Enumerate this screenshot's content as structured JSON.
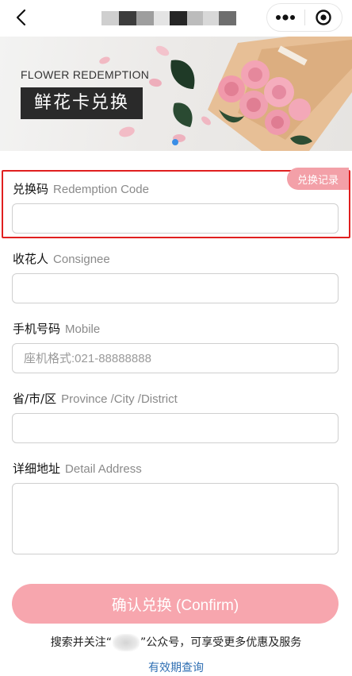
{
  "nav": {
    "back_icon": "chevron-left-icon",
    "more_icon": "more-dots-icon",
    "target_icon": "target-icon"
  },
  "banner": {
    "subtitle": "FLOWER REDEMPTION",
    "title": "鲜花卡兑换"
  },
  "form": {
    "redemption": {
      "label_cn": "兑换码",
      "label_en": "Redemption Code",
      "value": "",
      "placeholder": ""
    },
    "record_tag": "兑换记录",
    "consignee": {
      "label_cn": "收花人",
      "label_en": "Consignee",
      "value": "",
      "placeholder": ""
    },
    "mobile": {
      "label_cn": "手机号码",
      "label_en": "Mobile",
      "value": "",
      "placeholder": "座机格式:021-88888888"
    },
    "province": {
      "label_cn": "省/市/区",
      "label_en": "Province /City /District",
      "value": "",
      "placeholder": ""
    },
    "address": {
      "label_cn": "详细地址",
      "label_en": "Detail Address",
      "value": ""
    },
    "confirm_label": "确认兑换 (Confirm)"
  },
  "footer": {
    "note_prefix": "搜索并关注“",
    "note_suffix": "”公众号，可享受更多优惠及服务",
    "validity_link": "有效期查询"
  },
  "colors": {
    "accent_pink": "#f7a6ae",
    "highlight_red": "#e02020",
    "link_blue": "#2f6fb3",
    "dot_blue": "#3a8ee6"
  }
}
